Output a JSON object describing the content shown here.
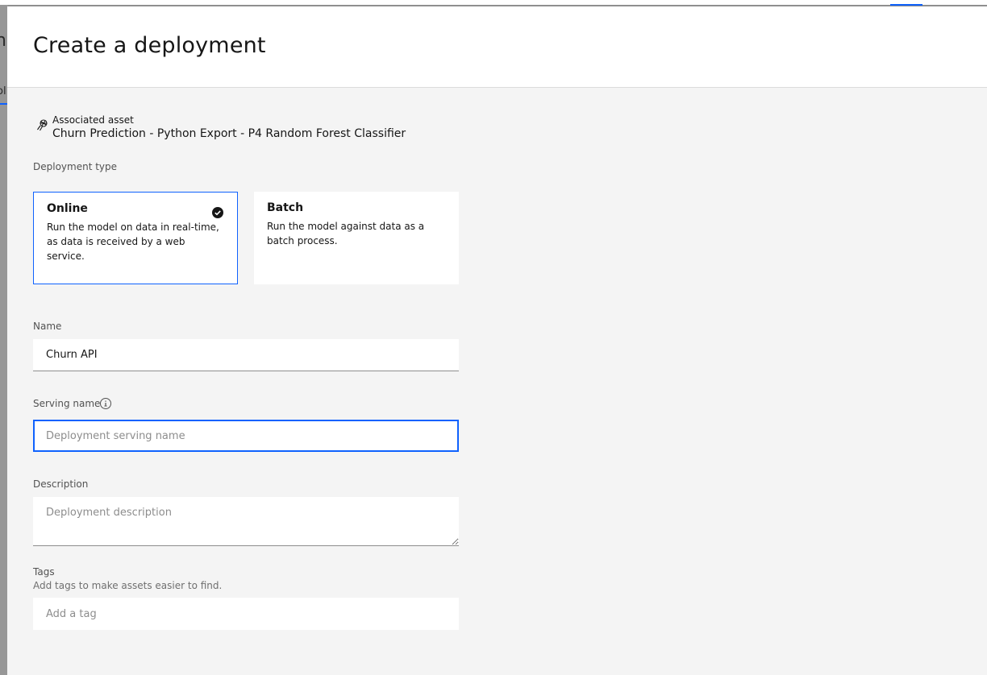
{
  "background": {
    "left_title_fragment": "n",
    "left_tab_fragment": "ol"
  },
  "modal": {
    "title": "Create a deployment"
  },
  "asset": {
    "label": "Associated asset",
    "name": "Churn Prediction - Python Export - P4 Random Forest Classifier",
    "icon": "model-icon"
  },
  "deployment_type": {
    "label": "Deployment type",
    "options": [
      {
        "title": "Online",
        "description": "Run the model on data in real-time, as data is received by a web service.",
        "selected": true
      },
      {
        "title": "Batch",
        "description": "Run the model against data as a batch process.",
        "selected": false
      }
    ]
  },
  "name_field": {
    "label": "Name",
    "value": "Churn API"
  },
  "serving_name": {
    "label": "Serving name",
    "placeholder": "Deployment serving name",
    "icon": "information-icon"
  },
  "description": {
    "label": "Description",
    "placeholder": "Deployment description"
  },
  "tags": {
    "label": "Tags",
    "helper": "Add tags to make assets easier to find.",
    "placeholder": "Add a tag"
  },
  "colors": {
    "accent": "#0f62fe",
    "panel": "#f4f4f4",
    "field": "#ffffff",
    "text": "#161616"
  }
}
